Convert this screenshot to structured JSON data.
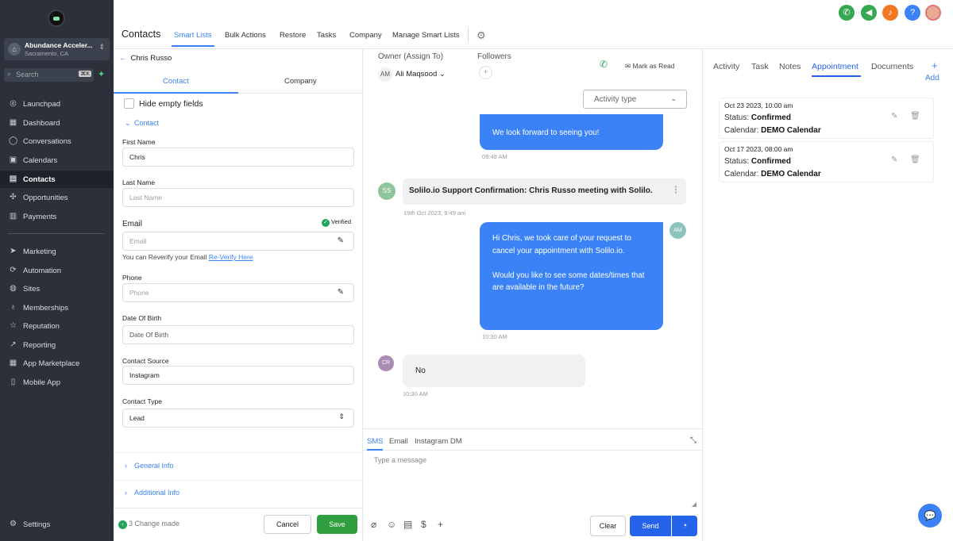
{
  "sidebar": {
    "account_name": "Abundance Acceler...",
    "account_location": "Sacramento, CA",
    "search_placeholder": "Search",
    "search_shortcut": "⌘K",
    "items": [
      {
        "label": "Launchpad",
        "icon": "rocket-icon"
      },
      {
        "label": "Dashboard",
        "icon": "grid-icon"
      },
      {
        "label": "Conversations",
        "icon": "chat-icon"
      },
      {
        "label": "Calendars",
        "icon": "calendar-icon"
      },
      {
        "label": "Contacts",
        "icon": "contacts-icon",
        "active": true
      },
      {
        "label": "Opportunities",
        "icon": "opportunities-icon"
      },
      {
        "label": "Payments",
        "icon": "payments-icon"
      },
      {
        "label": "Marketing",
        "icon": "send-icon"
      },
      {
        "label": "Automation",
        "icon": "automation-icon"
      },
      {
        "label": "Sites",
        "icon": "globe-icon"
      },
      {
        "label": "Memberships",
        "icon": "membership-icon"
      },
      {
        "label": "Reputation",
        "icon": "star-icon"
      },
      {
        "label": "Reporting",
        "icon": "chart-icon"
      },
      {
        "label": "App Marketplace",
        "icon": "apps-icon"
      },
      {
        "label": "Mobile App",
        "icon": "phone-icon"
      }
    ],
    "settings_label": "Settings"
  },
  "topbar": {
    "title": "Contacts",
    "tabs": [
      "Smart Lists",
      "Bulk Actions",
      "Restore",
      "Tasks",
      "Company",
      "Manage Smart Lists"
    ],
    "active_tab": "Smart Lists"
  },
  "contact_panel": {
    "back_label": "Chris Russo",
    "tabs": [
      "Contact",
      "Company"
    ],
    "hide_empty_label": "Hide empty fields",
    "section_contact": "Contact",
    "fields": {
      "first_name_label": "First Name",
      "first_name_value": "Chris",
      "last_name_label": "Last Name",
      "last_name_placeholder": "Last Name",
      "email_label": "Email",
      "email_placeholder": "Email",
      "verified_label": "Verified",
      "reverify_text": "You can Reverify your Email",
      "reverify_link": "Re-Verify Here",
      "phone_label": "Phone",
      "phone_placeholder": "Phone",
      "dob_label": "Date Of Birth",
      "dob_placeholder": "Date Of Birth",
      "source_label": "Contact Source",
      "source_value": "Instagram",
      "type_label": "Contact Type",
      "type_value": "Lead"
    },
    "section_general": "General Info",
    "section_additional": "Additional Info",
    "changes_text": "3 Change made",
    "cancel_label": "Cancel",
    "save_label": "Save"
  },
  "conversation": {
    "owner_label": "Owner (Assign To)",
    "owner_initials": "AM",
    "owner_name": "Ali Maqsood",
    "followers_label": "Followers",
    "mark_read_label": "Mark as Read",
    "activity_type_label": "Activity type",
    "messages": {
      "m1_text": "We look forward to seeing you!",
      "m1_time": "09:49 AM",
      "notice_initials": "SS",
      "notice_text": "Solilo.io Support  Confirmation: Chris Russo meeting with Solilo.",
      "notice_time": "19th Oct 2023, 9:49 am",
      "m2_initials": "AM",
      "m2_text": "Hi Chris, we took care of your request to cancel your appointment with Solilo.io.\n\nWould you like to see some dates/times that are available in the future?",
      "m2_time": "10:30 AM",
      "m3_initials": "CR",
      "m3_text": "No",
      "m3_time": "10:30 AM"
    },
    "composer_tabs": [
      "SMS",
      "Email",
      "Instagram DM"
    ],
    "composer_placeholder": "Type a message",
    "clear_label": "Clear",
    "send_label": "Send"
  },
  "right_panel": {
    "tabs": [
      "Activity",
      "Task",
      "Notes",
      "Appointment",
      "Documents"
    ],
    "active_tab": "Appointment",
    "add_label": "Add",
    "appointments": [
      {
        "date": "Oct 23 2023, 10:00 am",
        "status_label": "Status:",
        "status": "Confirmed",
        "calendar_label": "Calendar:",
        "calendar": "DEMO Calendar"
      },
      {
        "date": "Oct 17 2023, 08:00 am",
        "status_label": "Status:",
        "status": "Confirmed",
        "calendar_label": "Calendar:",
        "calendar": "DEMO Calendar"
      }
    ]
  },
  "colors": {
    "accent": "#3b82f6",
    "sidebar_bg": "#2b303a",
    "save_green": "#2e9e3e",
    "send_blue": "#2563eb"
  }
}
